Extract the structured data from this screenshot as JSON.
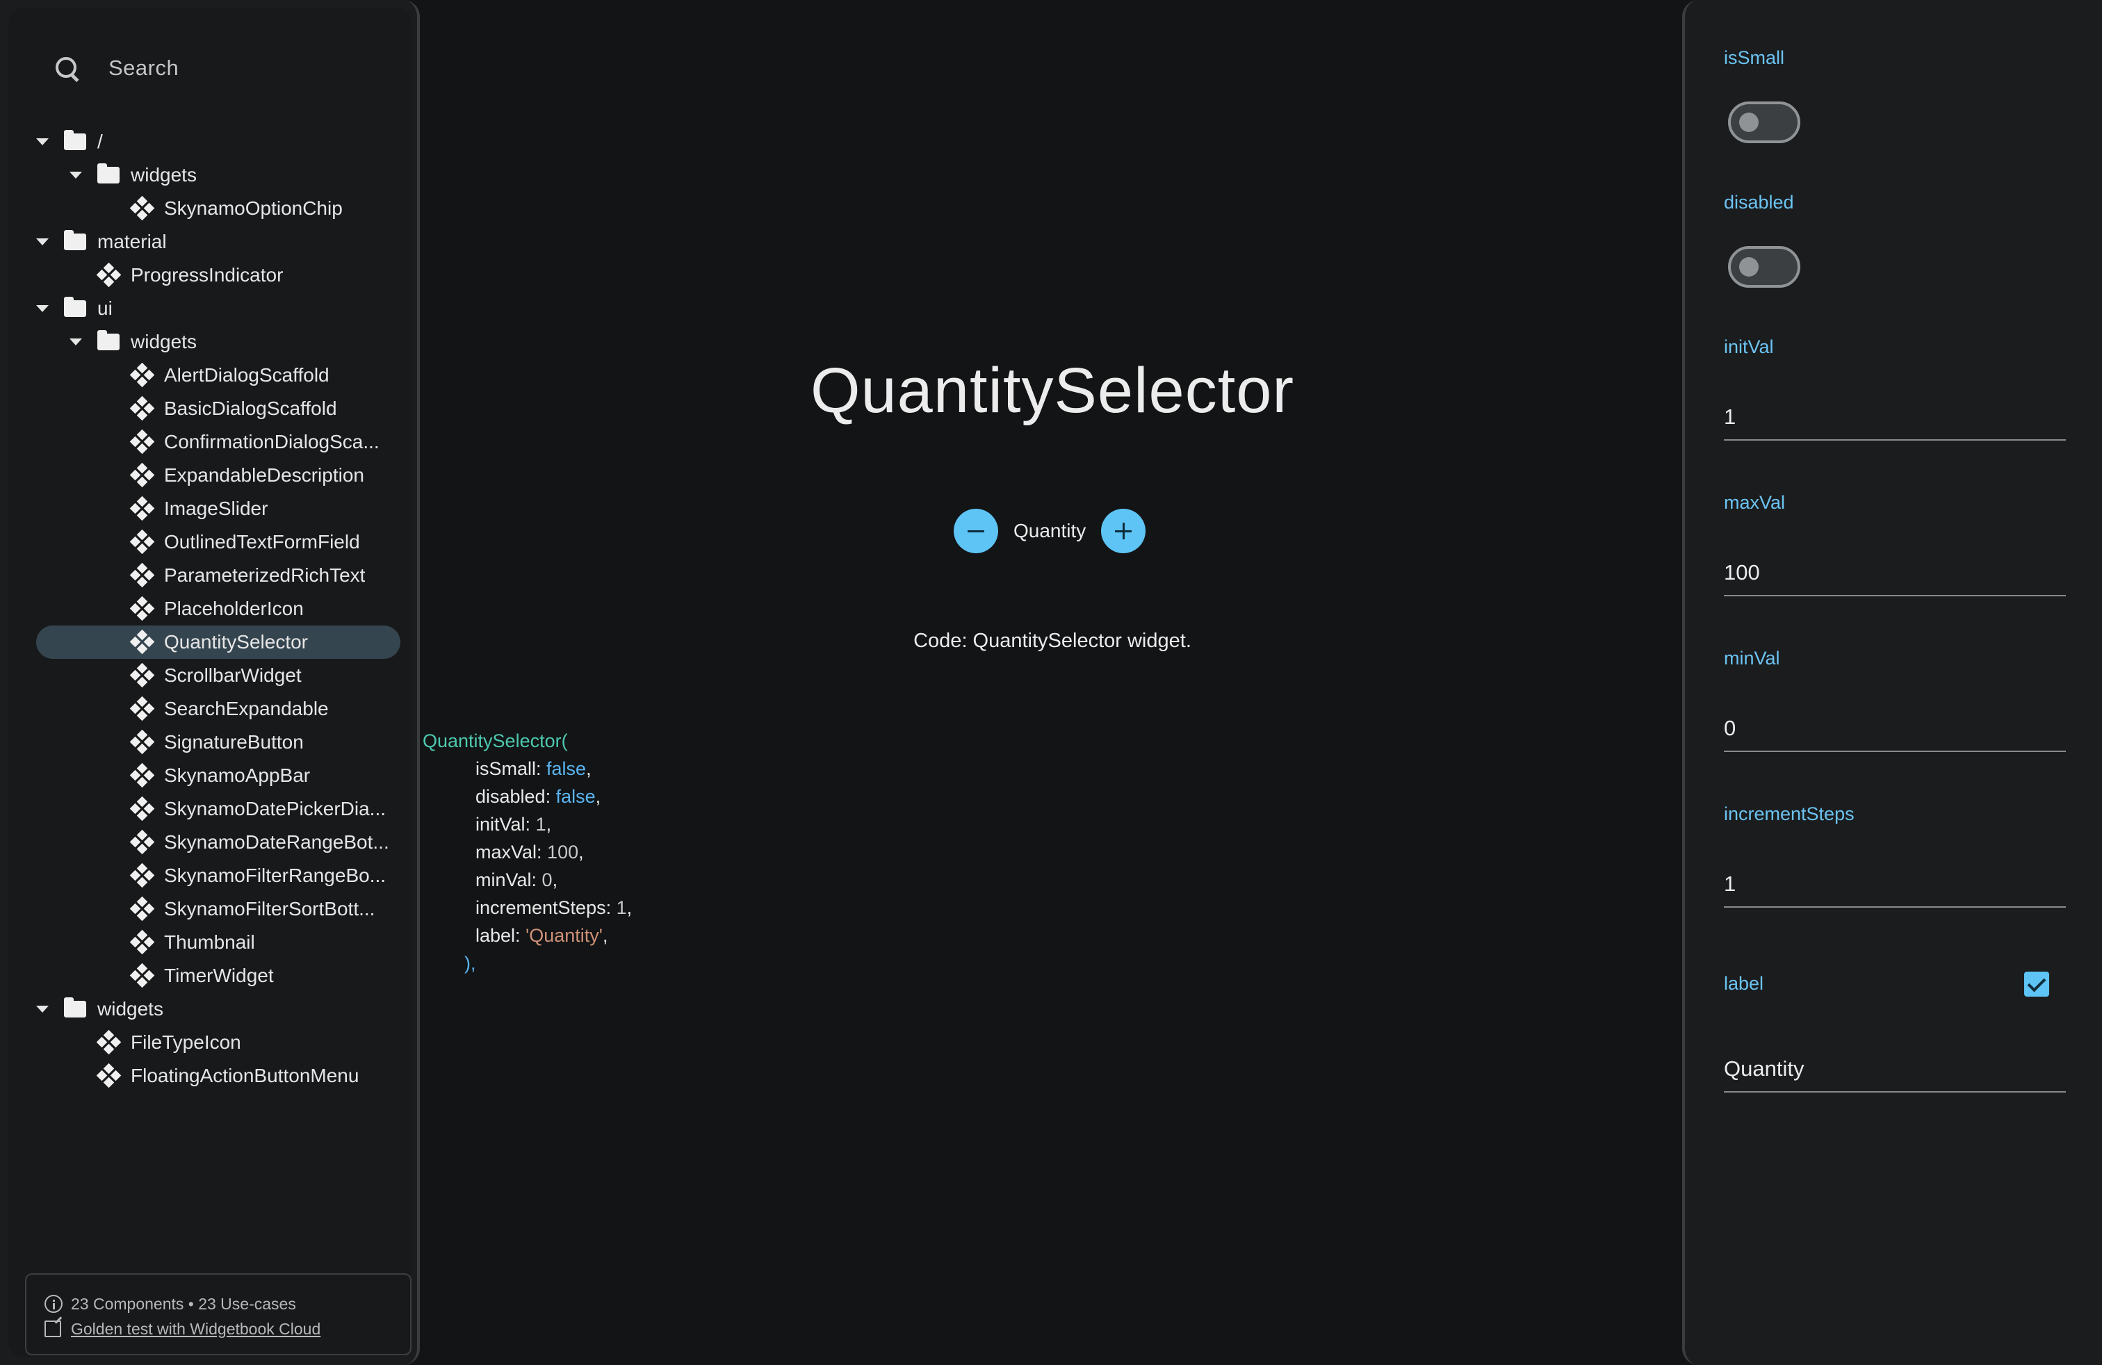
{
  "search": {
    "label": "Search"
  },
  "tree": [
    {
      "type": "folder",
      "depth": 0,
      "label": "/"
    },
    {
      "type": "folder",
      "depth": 1,
      "label": "widgets"
    },
    {
      "type": "component",
      "depth": 2,
      "label": "SkynamoOptionChip"
    },
    {
      "type": "folder",
      "depth": 0,
      "label": "material"
    },
    {
      "type": "component",
      "depth": 1,
      "label": "ProgressIndicator"
    },
    {
      "type": "folder",
      "depth": 0,
      "label": "ui"
    },
    {
      "type": "folder",
      "depth": 1,
      "label": "widgets"
    },
    {
      "type": "component",
      "depth": 2,
      "label": "AlertDialogScaffold"
    },
    {
      "type": "component",
      "depth": 2,
      "label": "BasicDialogScaffold"
    },
    {
      "type": "component",
      "depth": 2,
      "label": "ConfirmationDialogSca..."
    },
    {
      "type": "component",
      "depth": 2,
      "label": "ExpandableDescription"
    },
    {
      "type": "component",
      "depth": 2,
      "label": "ImageSlider"
    },
    {
      "type": "component",
      "depth": 2,
      "label": "OutlinedTextFormField"
    },
    {
      "type": "component",
      "depth": 2,
      "label": "ParameterizedRichText"
    },
    {
      "type": "component",
      "depth": 2,
      "label": "PlaceholderIcon"
    },
    {
      "type": "component",
      "depth": 2,
      "label": "QuantitySelector",
      "selected": true
    },
    {
      "type": "component",
      "depth": 2,
      "label": "ScrollbarWidget"
    },
    {
      "type": "component",
      "depth": 2,
      "label": "SearchExpandable"
    },
    {
      "type": "component",
      "depth": 2,
      "label": "SignatureButton"
    },
    {
      "type": "component",
      "depth": 2,
      "label": "SkynamoAppBar"
    },
    {
      "type": "component",
      "depth": 2,
      "label": "SkynamoDatePickerDia..."
    },
    {
      "type": "component",
      "depth": 2,
      "label": "SkynamoDateRangeBot..."
    },
    {
      "type": "component",
      "depth": 2,
      "label": "SkynamoFilterRangeBo..."
    },
    {
      "type": "component",
      "depth": 2,
      "label": "SkynamoFilterSortBott..."
    },
    {
      "type": "component",
      "depth": 2,
      "label": "Thumbnail"
    },
    {
      "type": "component",
      "depth": 2,
      "label": "TimerWidget"
    },
    {
      "type": "folder",
      "depth": 0,
      "label": "widgets"
    },
    {
      "type": "component",
      "depth": 1,
      "label": "FileTypeIcon"
    },
    {
      "type": "component",
      "depth": 1,
      "label": "FloatingActionButtonMenu"
    }
  ],
  "footer": {
    "stats": "23 Components • 23 Use-cases",
    "link": "Golden test with Widgetbook Cloud"
  },
  "preview": {
    "title": "QuantitySelector",
    "quantity_label": "Quantity",
    "caption": "Code: QuantitySelector widget."
  },
  "code": {
    "open": "QuantitySelector(",
    "lines": [
      {
        "key": "isSmall",
        "value": "false",
        "kind": "kw"
      },
      {
        "key": "disabled",
        "value": "false",
        "kind": "kw"
      },
      {
        "key": "initVal",
        "value": "1",
        "kind": "num"
      },
      {
        "key": "maxVal",
        "value": "100",
        "kind": "num"
      },
      {
        "key": "minVal",
        "value": "0",
        "kind": "num"
      },
      {
        "key": "incrementSteps",
        "value": "1",
        "kind": "num"
      },
      {
        "key": "label",
        "value": "'Quantity'",
        "kind": "str"
      }
    ],
    "close": "),"
  },
  "knobs": {
    "isSmall": {
      "label": "isSmall",
      "on": false
    },
    "disabled": {
      "label": "disabled",
      "on": false
    },
    "initVal": {
      "label": "initVal",
      "value": "1"
    },
    "maxVal": {
      "label": "maxVal",
      "value": "100"
    },
    "minVal": {
      "label": "minVal",
      "value": "0"
    },
    "incrementSteps": {
      "label": "incrementSteps",
      "value": "1"
    },
    "label": {
      "label": "label",
      "checked": true,
      "value": "Quantity"
    }
  },
  "colors": {
    "accent": "#5ec4f5",
    "knob_label": "#6cc3f2",
    "selected_row": "#35454f",
    "background": "#121415"
  }
}
